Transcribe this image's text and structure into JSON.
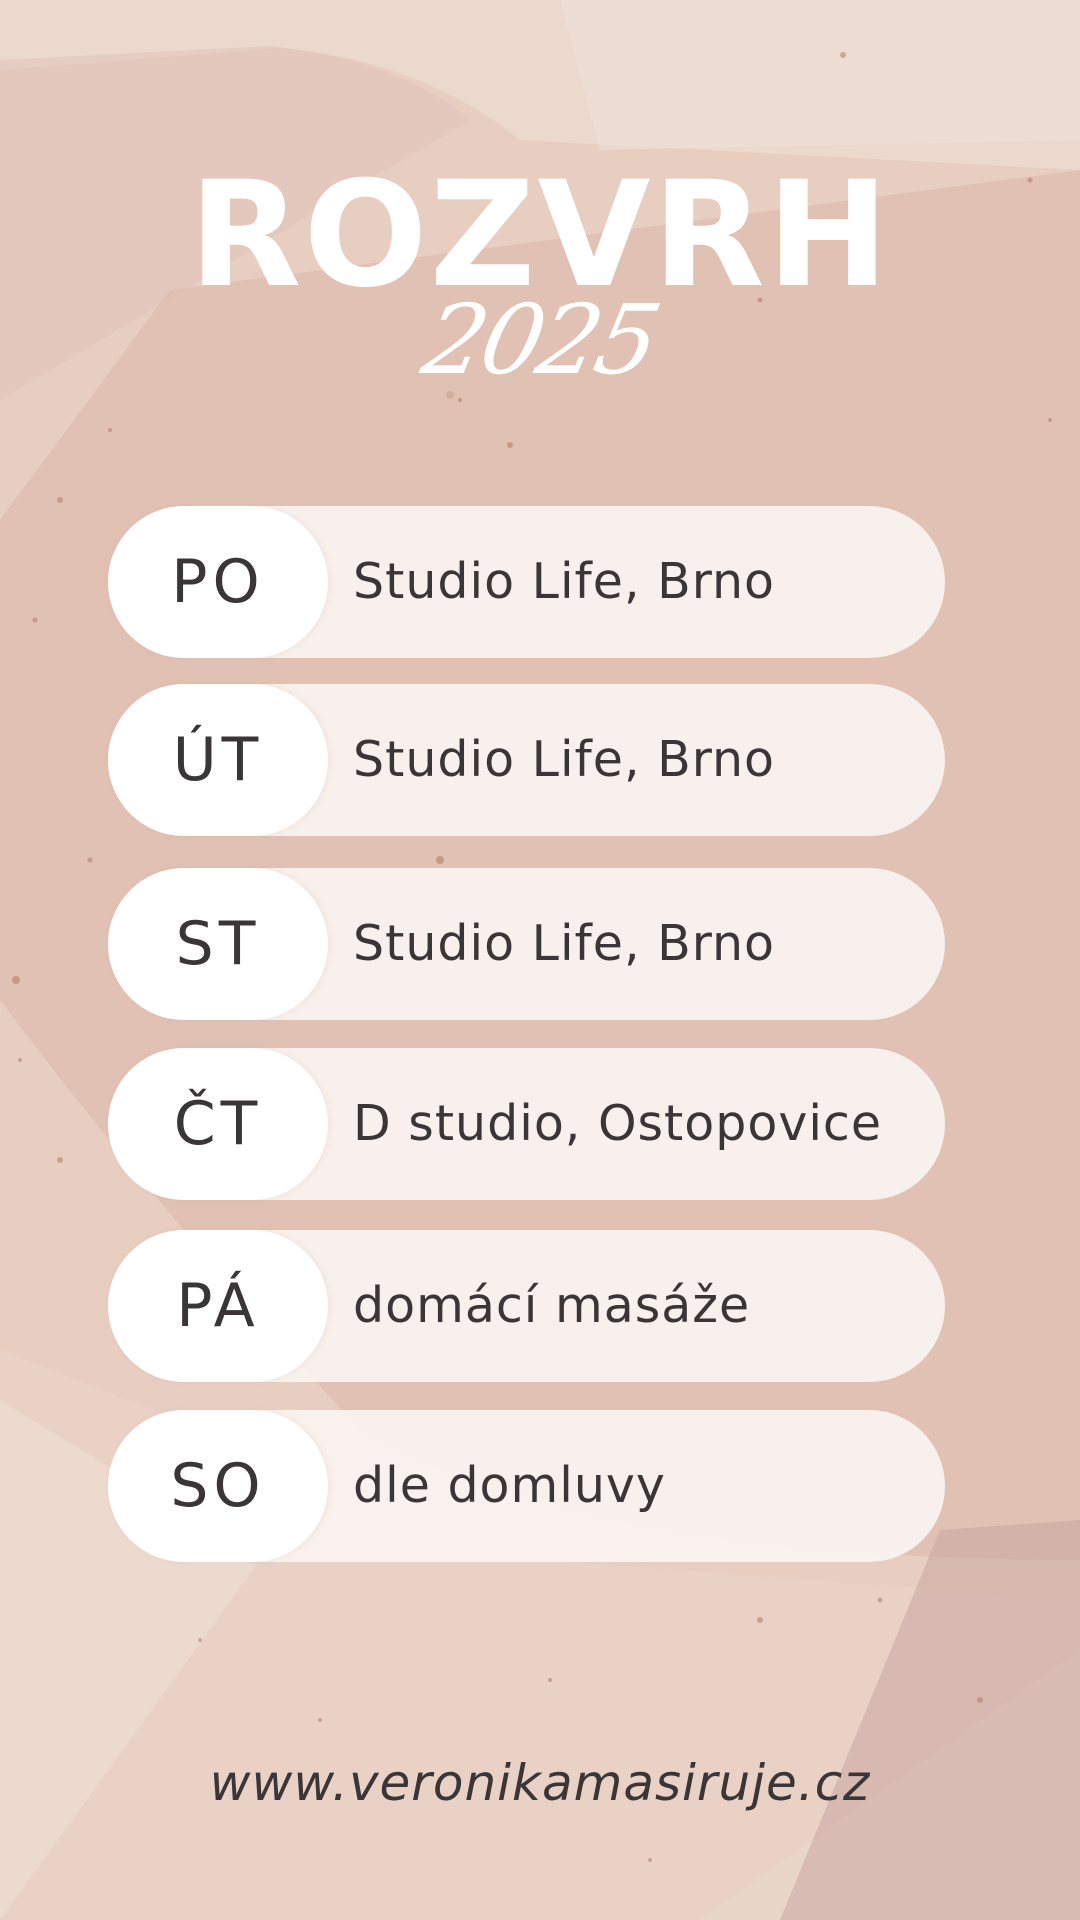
{
  "header": {
    "title": "ROZVRH",
    "year": "2025"
  },
  "schedule": [
    {
      "day": "PO",
      "place": "Studio Life, Brno"
    },
    {
      "day": "ÚT",
      "place": "Studio Life, Brno"
    },
    {
      "day": "ST",
      "place": "Studio Life, Brno"
    },
    {
      "day": "ČT",
      "place": "D studio, Ostopovice"
    },
    {
      "day": "PÁ",
      "place": "domácí masáže"
    },
    {
      "day": "SO",
      "place": "dle domluvy"
    }
  ],
  "footer": {
    "url": "www.veronikamasiruje.cz"
  },
  "colors": {
    "background": "#ecd8cd",
    "accent": "#d9b0a2",
    "text": "#3a3536",
    "pill": "#faf3f0",
    "white": "#ffffff"
  }
}
